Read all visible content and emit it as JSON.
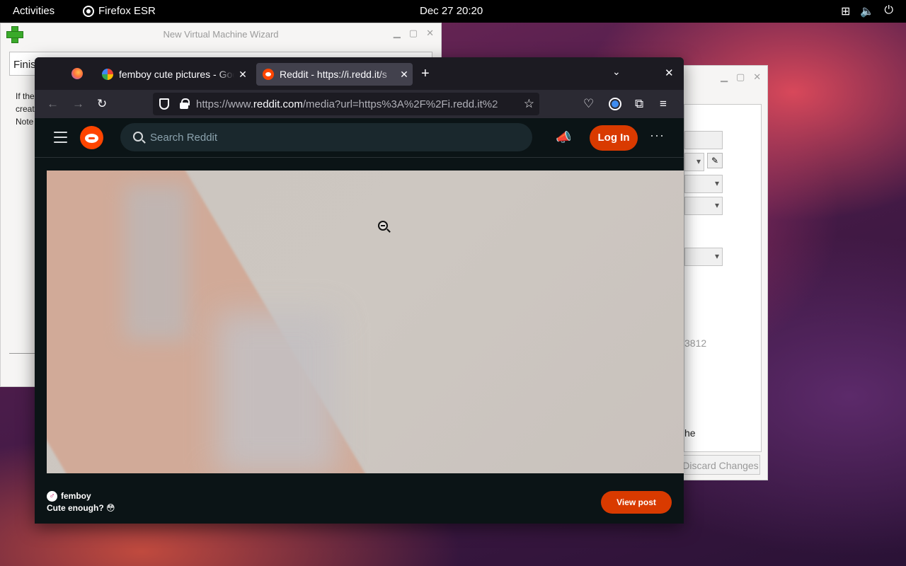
{
  "topbar": {
    "activities": "Activities",
    "app_name": "Firefox ESR",
    "clock": "Dec 27  20:20",
    "tray_icons": [
      "network-icon",
      "volume-icon",
      "power-icon"
    ]
  },
  "wizard": {
    "title": "New Virtual Machine Wizard",
    "field_value": "Finis",
    "text_lines": [
      "If the",
      "creat",
      "Note"
    ],
    "controls": [
      "minimize",
      "maximize",
      "close"
    ]
  },
  "vbox": {
    "partial_number": "3812",
    "partial_text": "he",
    "discard_label": "Discard Changes"
  },
  "firefox": {
    "tabs": [
      {
        "label": "femboy cute pictures - Google",
        "favicon": "google-icon",
        "active": false
      },
      {
        "label": "Reddit - https://i.redd.it/s",
        "favicon": "reddit-icon",
        "active": true
      }
    ],
    "new_tab_symbol": "+",
    "url_prefix": "https://www.",
    "url_host": "reddit.com",
    "url_rest": "/media?url=https%3A%2F%2Fi.redd.it%2"
  },
  "reddit": {
    "search_placeholder": "Search Reddit",
    "login_label": "Log In",
    "more_symbol": "···",
    "subreddit": "femboy",
    "post_title": "Cute enough? 😳",
    "view_post_label": "View post"
  },
  "colors": {
    "reddit_orange": "#d93a00",
    "firefox_dark": "#1c1b22",
    "reddit_bg": "#0b1416"
  }
}
